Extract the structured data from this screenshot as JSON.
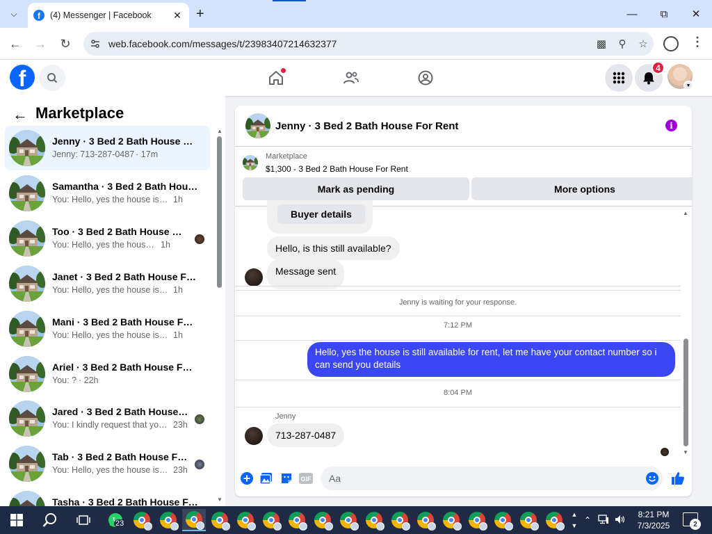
{
  "browser": {
    "tab_title": "(4) Messenger | Facebook",
    "url": "web.facebook.com/messages/t/23983407214632377"
  },
  "fb_header": {
    "notification_count": "4"
  },
  "sidebar": {
    "title": "Marketplace",
    "conversations": [
      {
        "name": "Jenny · 3 Bed 2 Bath House For Rent",
        "preview": "Jenny: 713-287-0487",
        "time": "· 17m",
        "active": true,
        "seen": false
      },
      {
        "name": "Samantha · 3 Bed 2 Bath House For Rent",
        "preview": "You: Hello, yes the house is still available for rent",
        "time": "1h",
        "active": false,
        "seen": false
      },
      {
        "name": "Too · 3 Bed 2 Bath House For Rent",
        "preview": "You: Hello, yes the house is still available for rent",
        "time": "1h",
        "active": false,
        "seen": true
      },
      {
        "name": "Janet · 3 Bed 2 Bath House For Rent",
        "preview": "You: Hello, yes the house is still available for rent",
        "time": "1h",
        "active": false,
        "seen": false
      },
      {
        "name": "Mani · 3 Bed 2 Bath House For Rent",
        "preview": "You: Hello, yes the house is still available for rent",
        "time": "1h",
        "active": false,
        "seen": false
      },
      {
        "name": "Ariel · 3 Bed 2 Bath House For Rent",
        "preview": "You: ?",
        "time": "· 22h",
        "active": false,
        "seen": false
      },
      {
        "name": "Jared · 3 Bed 2 Bath House For Rent",
        "preview": "You: I kindly request that you contact me",
        "time": "23h",
        "active": false,
        "seen": true
      },
      {
        "name": "Tab · 3 Bed 2 Bath House For Rent",
        "preview": "You: Hello, yes the house is still available for rent",
        "time": "23h",
        "active": false,
        "seen": true
      },
      {
        "name": "Tasha · 3 Bed 2 Bath House For Rent",
        "preview": "",
        "time": "",
        "active": false,
        "seen": false
      }
    ]
  },
  "chat": {
    "title": "Jenny · 3 Bed 2 Bath House For Rent",
    "listing_category": "Marketplace",
    "listing_summary": "$1,300 - 3 Bed 2 Bath House For Rent",
    "mark_pending_label": "Mark as pending",
    "more_options_label": "More options",
    "buyer_details_label": "Buyer details",
    "msg_still_available": "Hello, is this still available?",
    "msg_sent": "Message sent",
    "waiting_note": "Jenny is waiting for your response.",
    "time_1": "7:12 PM",
    "outgoing_line1": "Hello, yes the house is still available for rent, let me have your contact number so i",
    "outgoing_line2": "can send you  details",
    "time_2": "8:04 PM",
    "sender_name": "Jenny",
    "msg_phone": "713-287-0487",
    "input_placeholder": "Aa"
  },
  "taskbar": {
    "whatsapp_badge": "23",
    "time": "8:21 PM",
    "date": "7/3/2025",
    "notification_count": "2"
  },
  "colors": {
    "fb_blue": "#0866ff",
    "outgoing_bubble": "#3b46f5",
    "badge_red": "#e41e3f",
    "info_purple": "#a000e0",
    "active_conversation": "#ebf5ff"
  }
}
